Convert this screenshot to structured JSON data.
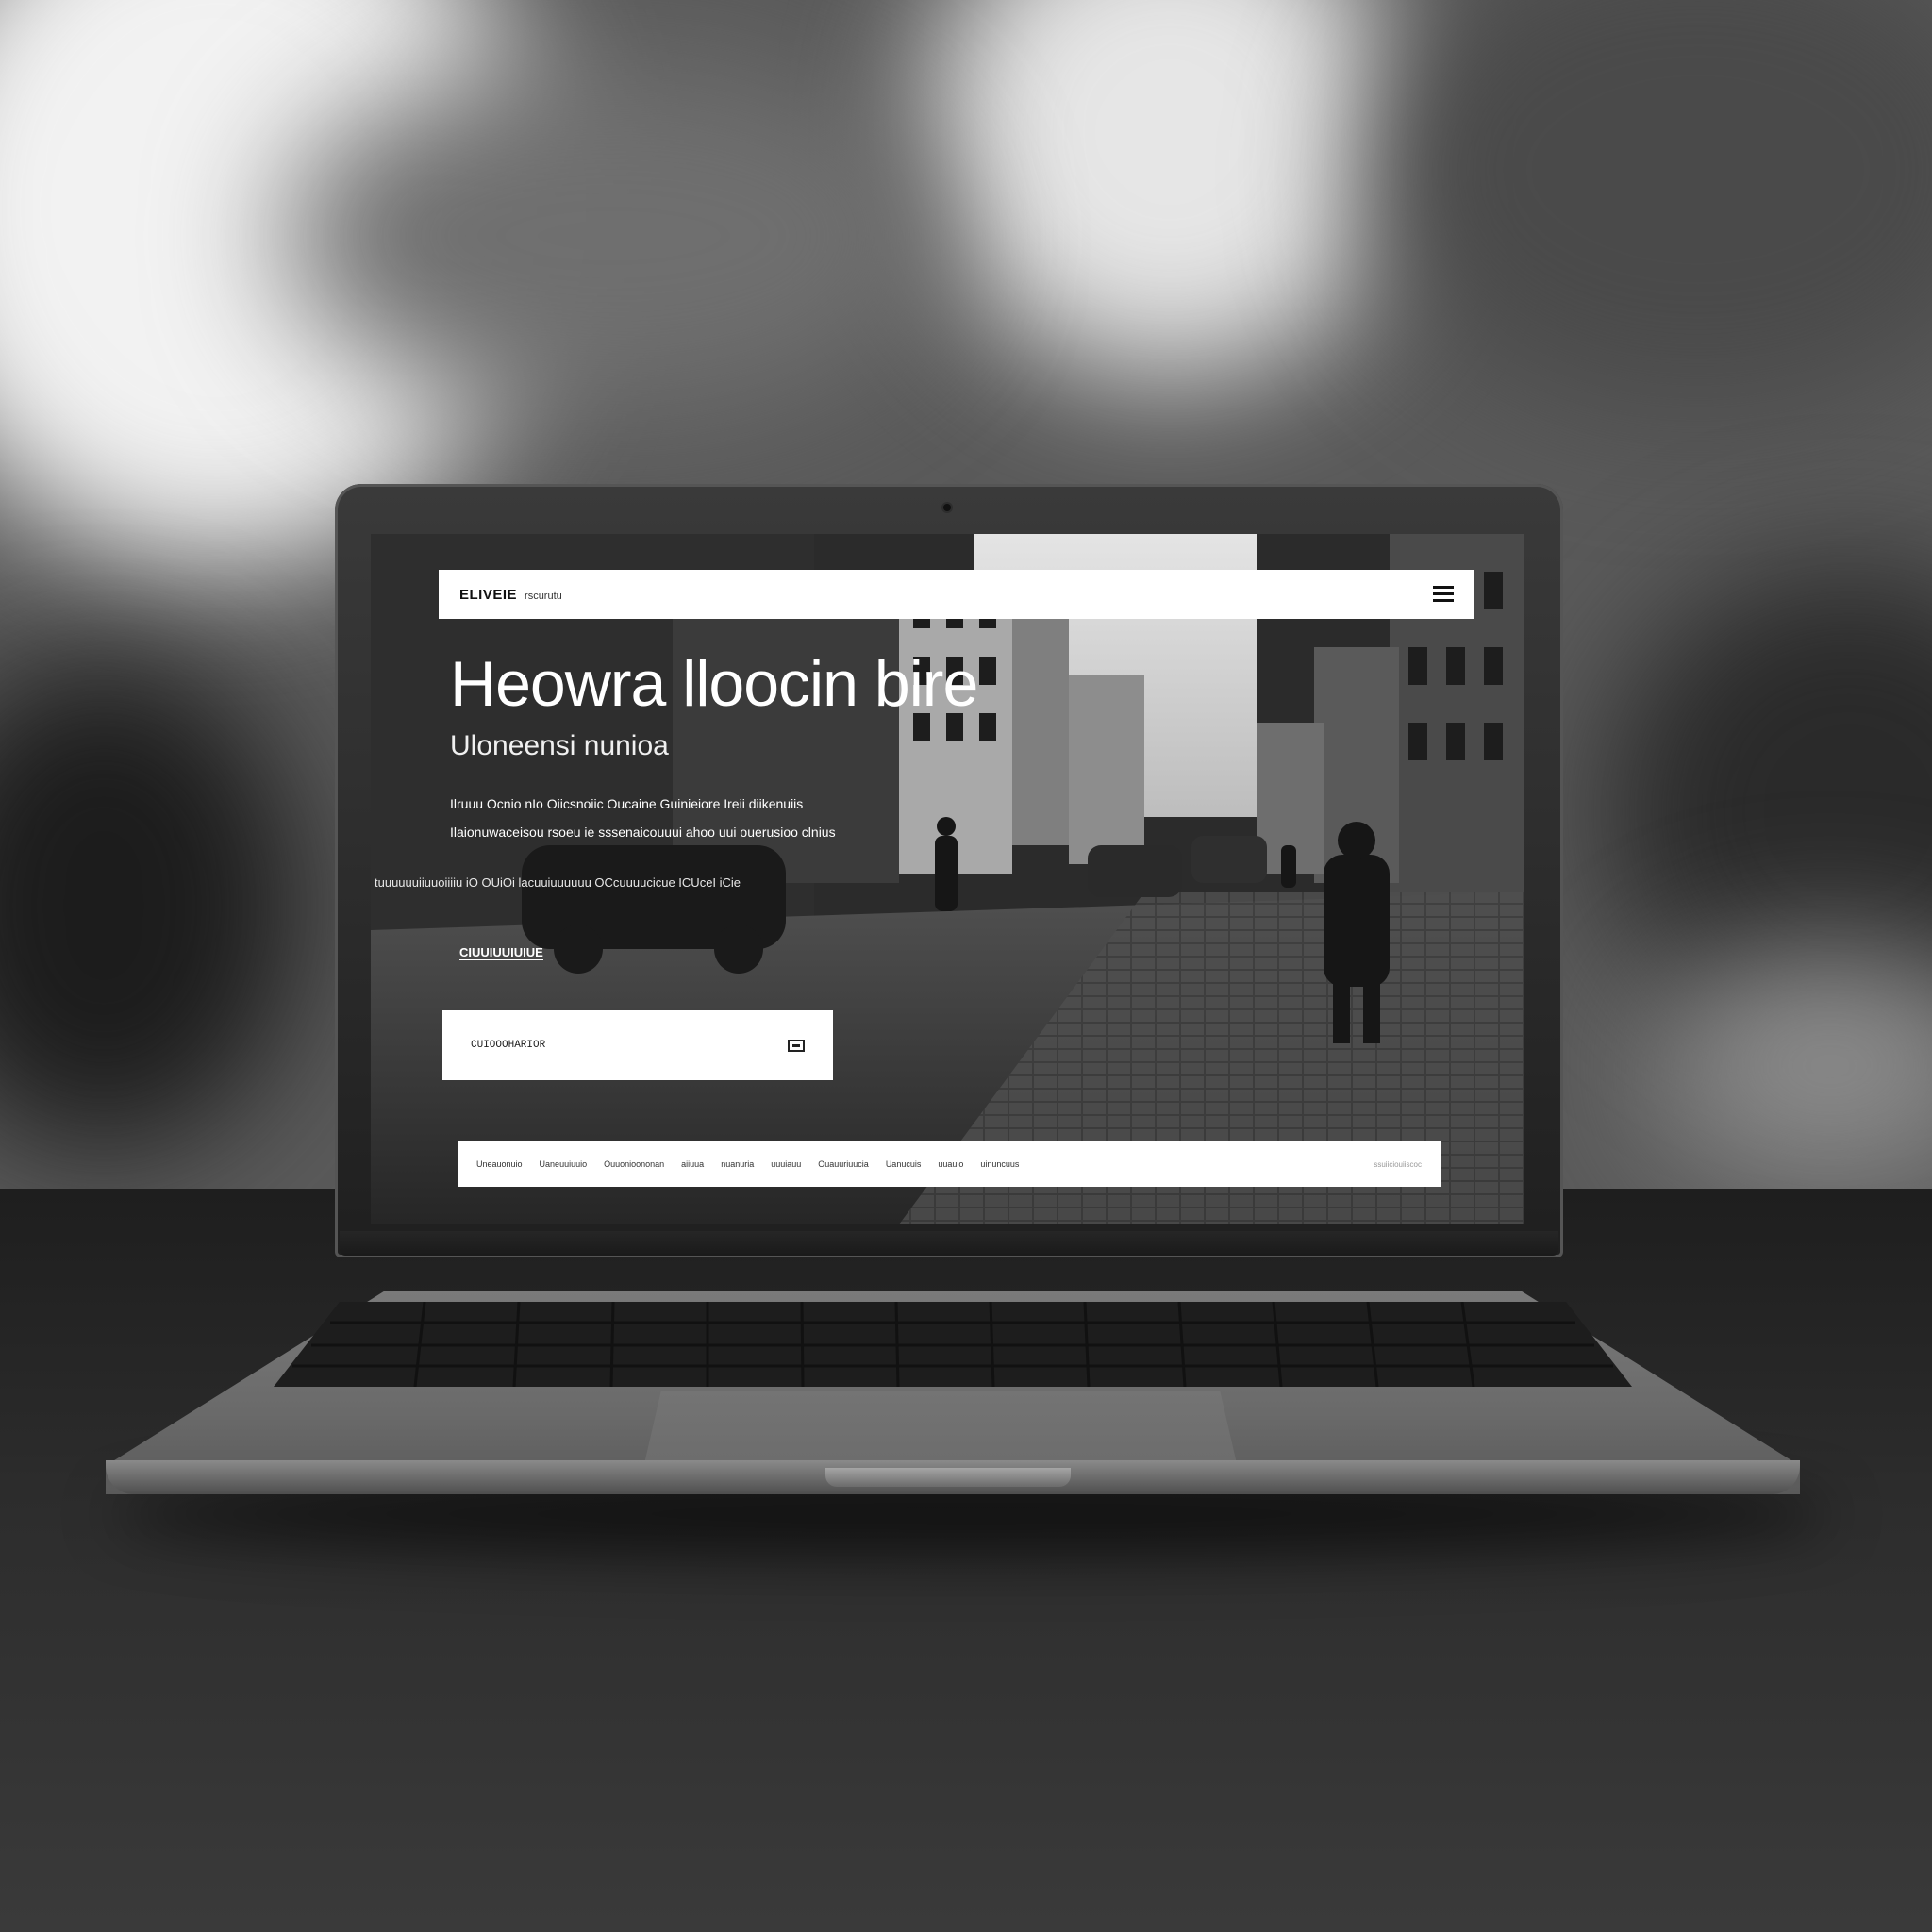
{
  "topbar": {
    "brand": "ELIVEIE",
    "tagline": "rscurutu"
  },
  "hero": {
    "title": "Heowra lloocin bire",
    "subtitle": "Uloneensi nunioa",
    "line1": "Ilruuu Ocnio nIo Oiicsnoiic Oucaine Guinieiore Ireii diikenuiis",
    "line2": "Ilaionuwaceisou rsoeu ie sssenaicouuui ahoo uui ouerusioo clnius",
    "line3": "tuuuuuuiiuuoiiiiu iO OUiOi lacuuiuuuuuu OCcuuuucicue ICUceI iCie",
    "link": "CIUUIUUIUIUE"
  },
  "search": {
    "placeholder": "CUIOOOHARIOR"
  },
  "bottom_nav": {
    "items": [
      "Uneauonuio",
      "Uaneuuiuuio",
      "Ouuonioononan",
      "aiiuua",
      "nuanuria",
      "uuuiauu",
      "Ouauuriuucia",
      "Uanucuis",
      "uuauio",
      "uinuncuus"
    ],
    "right": "ssuiiciouiiscoc"
  },
  "colors": {
    "bar_bg": "#ffffff",
    "text_dark": "#111111",
    "hero_text": "#ffffff"
  }
}
